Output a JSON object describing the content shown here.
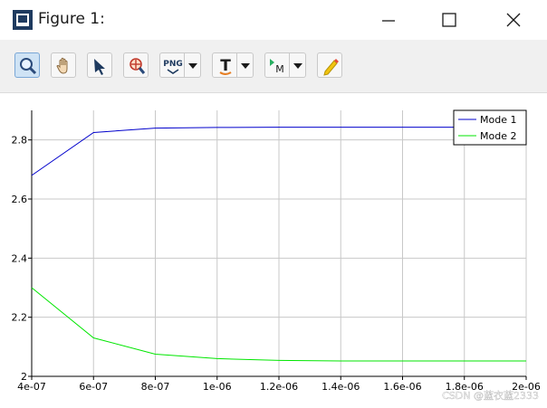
{
  "window": {
    "title": "Figure 1:",
    "controls": [
      "minimize",
      "maximize",
      "close"
    ]
  },
  "toolbar": {
    "tools": [
      {
        "name": "zoom",
        "icon": "magnifier-icon",
        "active": true
      },
      {
        "name": "pan",
        "icon": "hand-icon",
        "active": false
      },
      {
        "name": "select",
        "icon": "arrow-pointer-icon",
        "active": false
      },
      {
        "name": "zoom-out",
        "icon": "zoom-target-icon",
        "active": false
      },
      {
        "name": "export",
        "icon": "png-icon",
        "label": "PNG",
        "dropdown": true
      },
      {
        "name": "text",
        "icon": "text-T-icon",
        "label": "T",
        "dropdown": true
      },
      {
        "name": "marker",
        "icon": "marker-M-icon",
        "label": "M",
        "dropdown": true
      },
      {
        "name": "edit",
        "icon": "pencil-icon",
        "active": false
      }
    ]
  },
  "colors": {
    "mode1": "#0000cc",
    "mode2": "#00e600",
    "grid": "#c8c8c8",
    "toolbar_bg": "#f0f0f0"
  },
  "chart_data": {
    "type": "line",
    "x_tick_labels": [
      "4e-07",
      "6e-07",
      "8e-07",
      "1e-06",
      "1.2e-06",
      "1.4e-06",
      "1.6e-06",
      "1.8e-06",
      "2e-06"
    ],
    "y_tick_labels": [
      "2",
      "2.2",
      "2.4",
      "2.6",
      "2.8"
    ],
    "xlim": [
      4e-07,
      2e-06
    ],
    "ylim": [
      2.0,
      2.9
    ],
    "x": [
      4e-07,
      6e-07,
      8e-07,
      1e-06,
      1.2e-06,
      1.4e-06,
      1.6e-06,
      1.8e-06,
      2e-06
    ],
    "series": [
      {
        "name": "Mode 1",
        "color": "#0000cc",
        "values": [
          2.68,
          2.825,
          2.84,
          2.842,
          2.843,
          2.843,
          2.843,
          2.843,
          2.843
        ]
      },
      {
        "name": "Mode 2",
        "color": "#00e600",
        "values": [
          2.3,
          2.13,
          2.075,
          2.06,
          2.054,
          2.052,
          2.052,
          2.052,
          2.052
        ]
      }
    ],
    "grid": true,
    "legend_position": "top-right",
    "watermark": "CSDN @蓝衣蓝2333"
  }
}
